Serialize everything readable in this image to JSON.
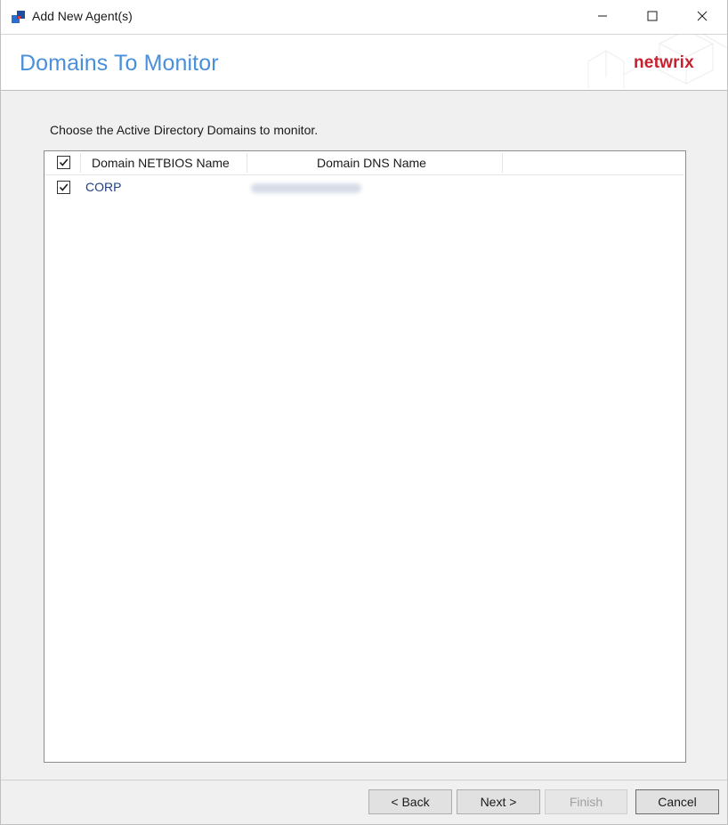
{
  "window": {
    "title": "Add New Agent(s)"
  },
  "header": {
    "page_title": "Domains To Monitor",
    "logo": "netwrix",
    "logo_color": "#c8202f",
    "title_color": "#4a8fd9"
  },
  "content": {
    "instruction": "Choose the Active Directory Domains to monitor.",
    "columns": [
      "Domain NETBIOS Name",
      "Domain DNS Name"
    ],
    "select_all_checked": true,
    "rows": [
      {
        "checked": true,
        "netbios": "CORP",
        "dns": ""
      }
    ]
  },
  "buttons": {
    "back": "< Back",
    "next": "Next >",
    "finish": "Finish",
    "cancel": "Cancel"
  },
  "icons": {
    "app": "netwrix-app-icon",
    "minimize": "minimize-icon",
    "maximize": "maximize-icon",
    "close": "close-icon",
    "check": "checkmark-icon"
  }
}
